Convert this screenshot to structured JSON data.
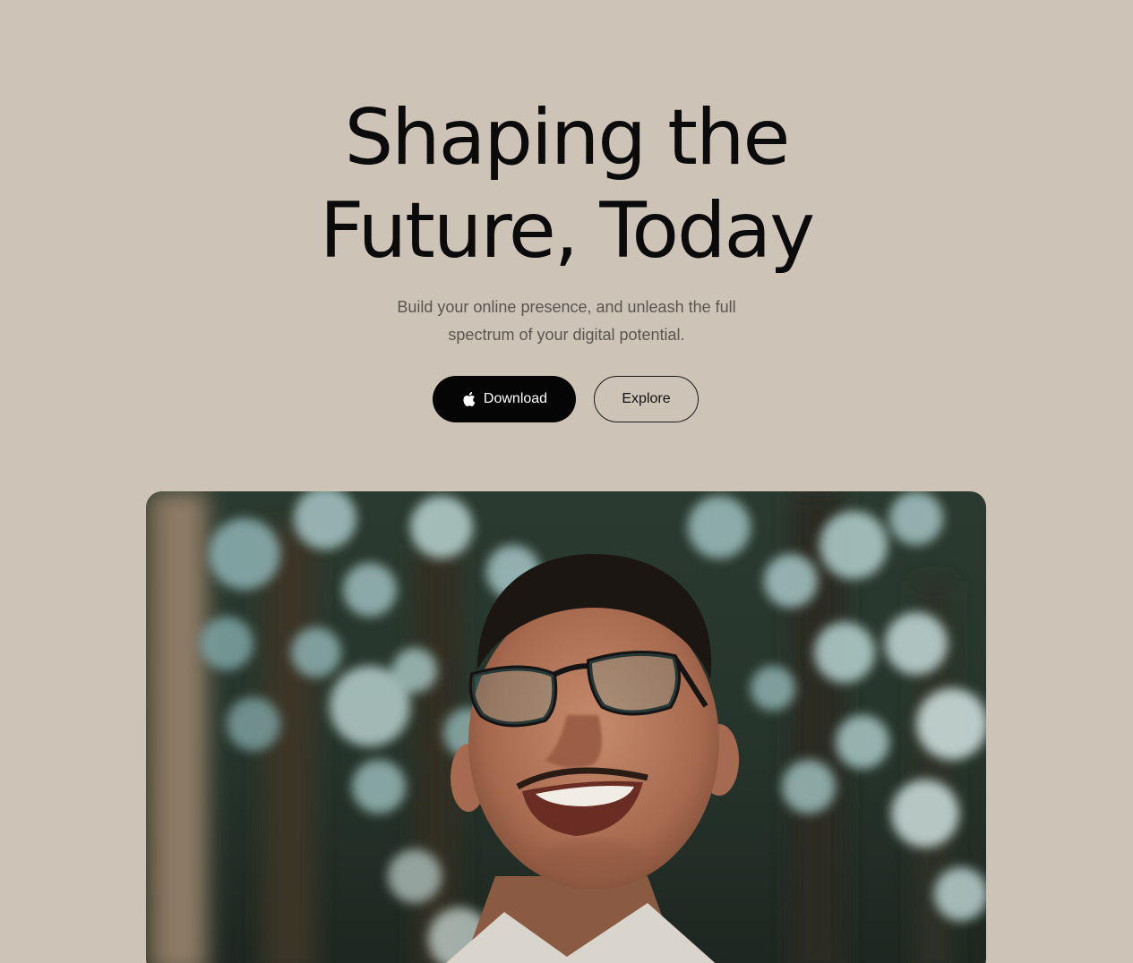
{
  "hero": {
    "headline_line1": "Shaping the",
    "headline_line2": "Future, Today",
    "subtitle_line1": "Build your online presence, and unleash the full",
    "subtitle_line2": "spectrum of your digital potential.",
    "download_label": "Download",
    "download_icon": "apple-icon",
    "explore_label": "Explore"
  },
  "colors": {
    "background": "#cdc3b7",
    "headline": "#0b0b0b",
    "subtitle": "#5b554f",
    "primary_button": "#050505"
  }
}
